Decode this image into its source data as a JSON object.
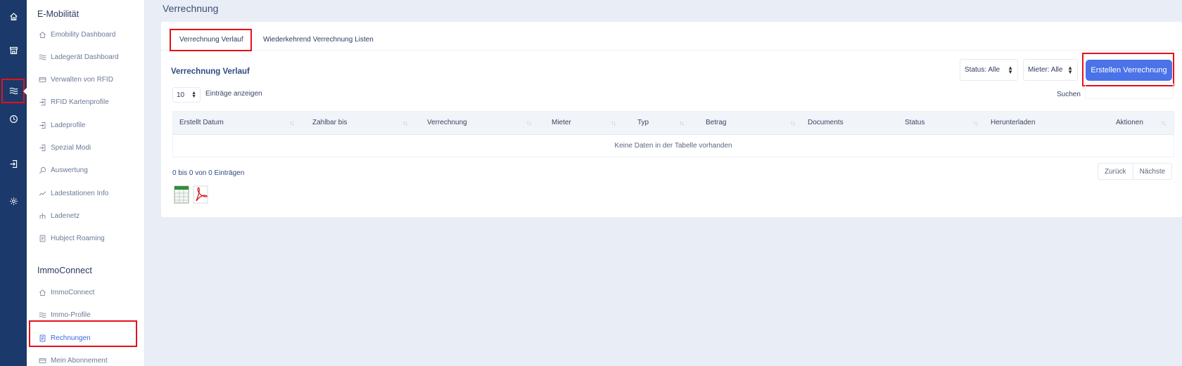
{
  "rail": {
    "icons": [
      "home-icon",
      "store-icon",
      "waves-icon",
      "clock-icon",
      "login-icon",
      "gear-icon"
    ]
  },
  "sidebar": {
    "emobility_title": "E-Mobilität",
    "emobility_items": [
      {
        "label": "Emobility Dashboard",
        "icon": "home-icon"
      },
      {
        "label": "Ladegerät Dashboard",
        "icon": "waves-icon"
      },
      {
        "label": "Verwalten von RFID",
        "icon": "card-icon"
      },
      {
        "label": "RFID Kartenprofile",
        "icon": "login-icon"
      },
      {
        "label": "Ladeprofile",
        "icon": "login-icon"
      },
      {
        "label": "Spezial Modi",
        "icon": "login-icon"
      },
      {
        "label": "Auswertung",
        "icon": "search-icon"
      },
      {
        "label": "Ladestationen Info",
        "icon": "trend-icon"
      },
      {
        "label": "Ladenetz",
        "icon": "network-icon"
      },
      {
        "label": "Hubject Roaming",
        "icon": "document-icon"
      }
    ],
    "immo_title": "ImmoConnect",
    "immo_items": [
      {
        "label": "ImmoConnect",
        "icon": "home-icon"
      },
      {
        "label": "Immo-Profile",
        "icon": "waves-icon"
      },
      {
        "label": "Rechnungen",
        "icon": "document-icon"
      },
      {
        "label": "Mein Abonnement",
        "icon": "card-icon"
      }
    ]
  },
  "page": {
    "title": "Verrechnung"
  },
  "tabs": [
    "Verrechnung Verlauf",
    "Wiederkehrend Verrechnung Listen"
  ],
  "card": {
    "title": "Verrechnung Verlauf",
    "status_filter": "Status: Alle",
    "tenant_filter": "Mieter: Alle",
    "create_button": "Erstellen Verrechnung",
    "length_value": "10",
    "length_label": "Einträge anzeigen",
    "search_label": "Suchen"
  },
  "table": {
    "headers": [
      "Erstellt Datum",
      "Zahlbar bis",
      "Verrechnung",
      "Mieter",
      "Typ",
      "Betrag",
      "Documents",
      "Status",
      "Herunterladen",
      "Aktionen"
    ],
    "empty_text": "Keine Daten in der Tabelle vorhanden"
  },
  "footer": {
    "info": "0 bis 0 von 0 Einträgen",
    "prev": "Zurück",
    "next": "Nächste"
  },
  "colors": {
    "rail": "#1b3a6b",
    "accent": "#4a73e8",
    "highlight": "#e5101a"
  }
}
